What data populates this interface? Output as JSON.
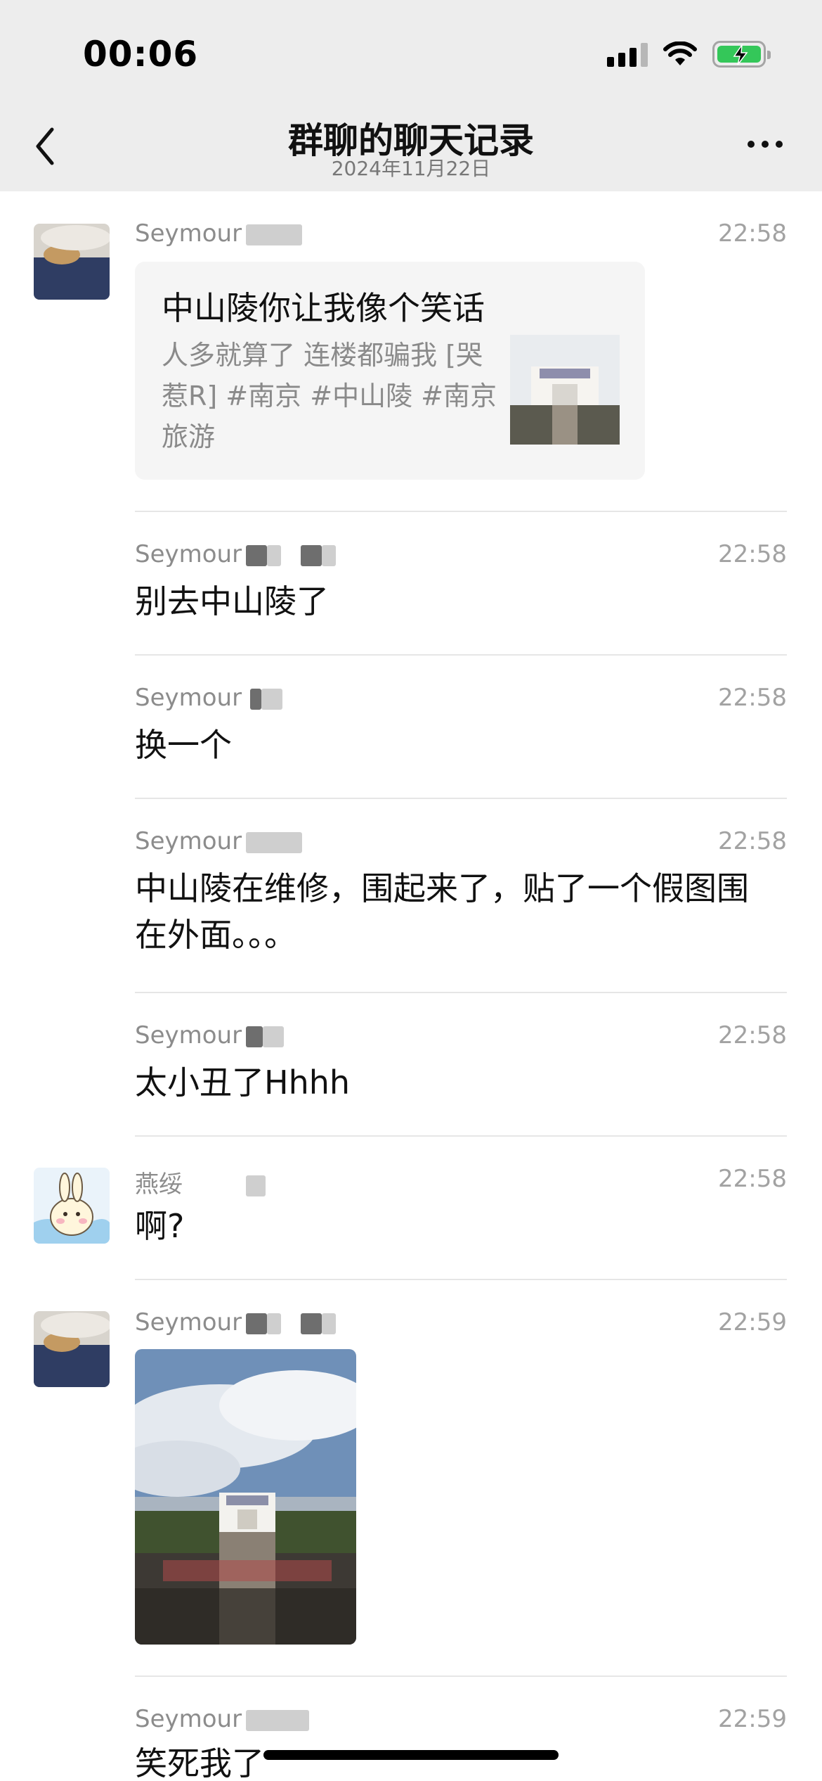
{
  "status_bar": {
    "time": "00:06"
  },
  "nav": {
    "title": "群聊的聊天记录",
    "subtitle": "2024年11月22日"
  },
  "messages": [
    {
      "sender": "Seymour",
      "time": "22:58",
      "type": "link-card",
      "card": {
        "title": "中山陵你让我像个笑话",
        "description": "人多就算了 连楼都骗我 [哭惹R] #南京 #中山陵 #南京旅游"
      }
    },
    {
      "sender": "Seymour",
      "time": "22:58",
      "text": "别去中山陵了"
    },
    {
      "sender": "Seymour",
      "time": "22:58",
      "text": "换一个"
    },
    {
      "sender": "Seymour",
      "time": "22:58",
      "text": "中山陵在维修，围起来了，贴了一个假图围在外面。。。"
    },
    {
      "sender": "Seymour",
      "time": "22:58",
      "text": "太小丑了Hhhh"
    },
    {
      "sender": "燕绥",
      "time": "22:58",
      "text": "啊?"
    },
    {
      "sender": "Seymour",
      "time": "22:59",
      "type": "image"
    },
    {
      "sender": "Seymour",
      "time": "22:59",
      "text": "笑死我了"
    }
  ]
}
